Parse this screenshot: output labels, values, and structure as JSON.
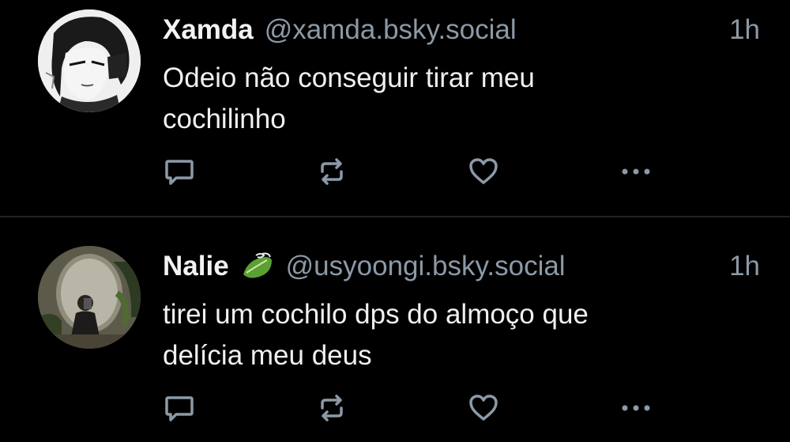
{
  "posts": [
    {
      "author_name": "Xamda",
      "author_handle": "@xamda.bsky.social",
      "timestamp": "1h",
      "text_line1": "Odeio não conseguir tirar meu",
      "text_line2": "cochilinho",
      "avatar": "avatar-illustration"
    },
    {
      "author_name": "Nalie",
      "author_handle": "@usyoongi.bsky.social",
      "timestamp": "1h",
      "text_line1": "tirei um cochilo dps do almoço que",
      "text_line2": "delícia meu deus",
      "avatar": "avatar-photo",
      "badge_icon": "leaf-emoji"
    }
  ],
  "icons": {
    "reply": "comment-icon",
    "repost": "repost-icon",
    "like": "heart-icon",
    "more": "more-icon"
  },
  "colors": {
    "background": "#000000",
    "text_primary": "#f1f3f4",
    "text_secondary": "#8c99a6",
    "divider": "#1e2329"
  }
}
